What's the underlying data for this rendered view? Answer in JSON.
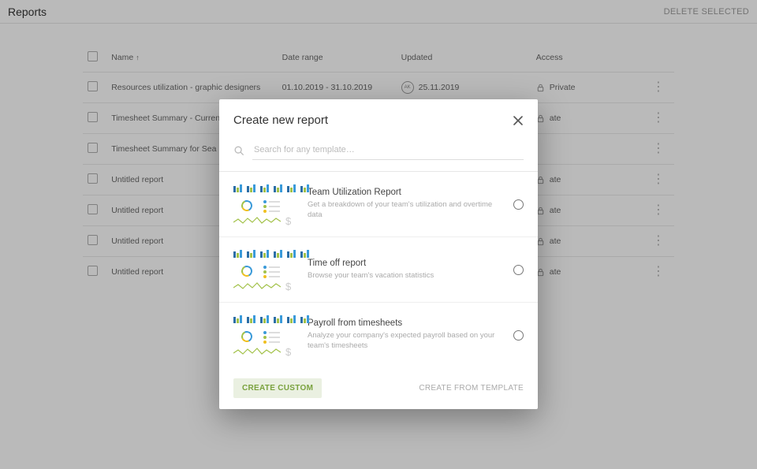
{
  "header": {
    "title": "Reports",
    "delete": "DELETE SELECTED"
  },
  "columns": {
    "name": "Name",
    "date_range": "Date range",
    "updated": "Updated",
    "access": "Access"
  },
  "rows": [
    {
      "name": "Resources utilization - graphic designers",
      "range": "01.10.2019 - 31.10.2019",
      "updated": "25.11.2019",
      "avatar": "AK",
      "access": "Private"
    },
    {
      "name": "Timesheet Summary - Current Month",
      "range": "",
      "updated": "",
      "avatar": "",
      "access": "ate"
    },
    {
      "name": "Timesheet Summary for Sea Hotels b",
      "range": "",
      "updated": "",
      "avatar": "",
      "access": ""
    },
    {
      "name": "Untitled report",
      "range": "",
      "updated": "",
      "avatar": "",
      "access": "ate"
    },
    {
      "name": "Untitled report",
      "range": "",
      "updated": "",
      "avatar": "",
      "access": "ate"
    },
    {
      "name": "Untitled report",
      "range": "",
      "updated": "",
      "avatar": "",
      "access": "ate"
    },
    {
      "name": "Untitled report",
      "range": "",
      "updated": "",
      "avatar": "",
      "access": "ate"
    }
  ],
  "modal": {
    "title": "Create new report",
    "search_placeholder": "Search for any template…",
    "templates": [
      {
        "title": "Team Utilization Report",
        "desc": "Get a breakdown of your team's utilization and overtime data"
      },
      {
        "title": "Time off report",
        "desc": "Browse your team's vacation statistics"
      },
      {
        "title": "Payroll from timesheets",
        "desc": "Analyze your company's expected payroll based on your team's timesheets"
      }
    ],
    "create_custom": "CREATE CUSTOM",
    "create_from_template": "CREATE FROM TEMPLATE"
  }
}
